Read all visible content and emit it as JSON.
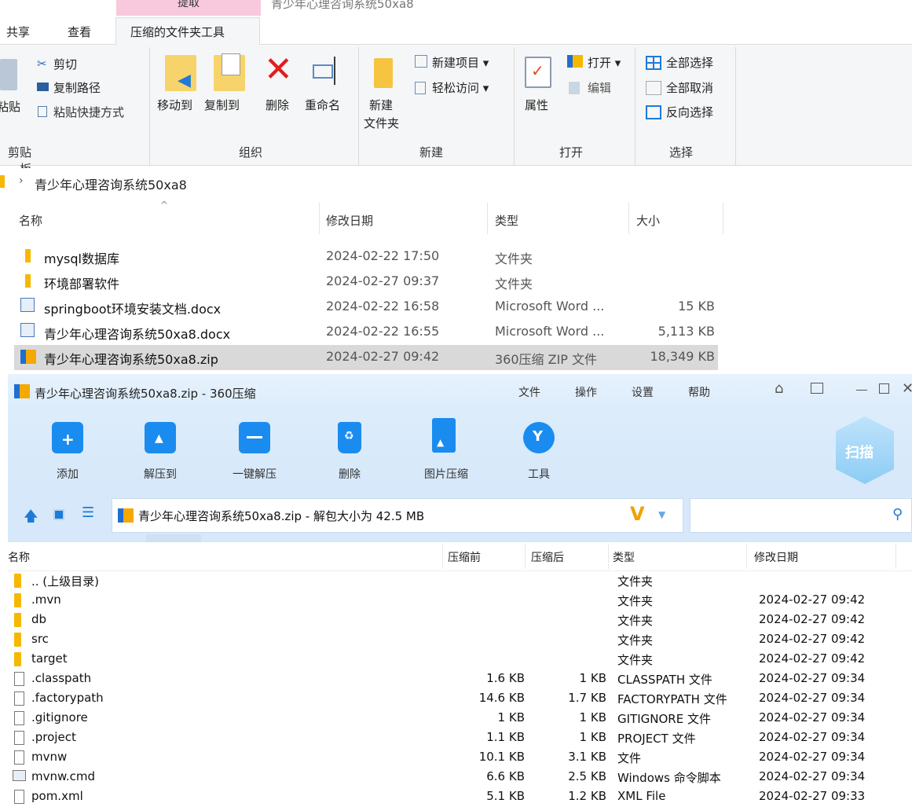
{
  "ribbon": {
    "context_tab": "提取",
    "window_title": "青少年心理咨询系统50xa8",
    "tabs": [
      "共享",
      "查看",
      "压缩的文件夹工具"
    ],
    "clipboard": {
      "paste": "粘贴",
      "cut": "剪切",
      "copy_path": "复制路径",
      "paste_shortcut": "粘贴快捷方式",
      "label": "剪贴板"
    },
    "organize": {
      "move_to": "移动到",
      "copy_to": "复制到",
      "delete": "删除",
      "rename": "重命名",
      "label": "组织"
    },
    "new": {
      "new_folder_1": "新建",
      "new_folder_2": "文件夹",
      "new_item": "新建项目 ▾",
      "easy_access": "轻松访问 ▾",
      "label": "新建"
    },
    "open": {
      "properties": "属性",
      "open": "打开 ▾",
      "edit": "编辑",
      "label": "打开"
    },
    "select": {
      "select_all": "全部选择",
      "select_none": "全部取消",
      "invert": "反向选择",
      "label": "选择"
    }
  },
  "address": {
    "path": "青少年心理咨询系统50xa8"
  },
  "explorer": {
    "columns": {
      "name": "名称",
      "date": "修改日期",
      "type": "类型",
      "size": "大小"
    },
    "rows": [
      {
        "name": "mysql数据库",
        "date": "2024-02-22 17:50",
        "type": "文件夹",
        "size": "",
        "icon": "folder"
      },
      {
        "name": "环境部署软件",
        "date": "2024-02-27 09:37",
        "type": "文件夹",
        "size": "",
        "icon": "folder"
      },
      {
        "name": "springboot环境安装文档.docx",
        "date": "2024-02-22 16:58",
        "type": "Microsoft Word ...",
        "size": "15 KB",
        "icon": "word"
      },
      {
        "name": "青少年心理咨询系统50xa8.docx",
        "date": "2024-02-22 16:55",
        "type": "Microsoft Word ...",
        "size": "5,113 KB",
        "icon": "word"
      },
      {
        "name": "青少年心理咨询系统50xa8.zip",
        "date": "2024-02-27 09:42",
        "type": "360压缩 ZIP 文件",
        "size": "18,349 KB",
        "icon": "zip"
      }
    ]
  },
  "zip": {
    "title": "青少年心理咨询系统50xa8.zip - 360压缩",
    "menu": [
      "文件",
      "操作",
      "设置",
      "帮助"
    ],
    "tools": [
      "添加",
      "解压到",
      "一键解压",
      "删除",
      "图片压缩",
      "工具"
    ],
    "scan": "扫描",
    "path": "青少年心理咨询系统50xa8.zip - 解包大小为 42.5 MB",
    "columns": {
      "name": "名称",
      "before": "压缩前",
      "after": "压缩后",
      "type": "类型",
      "date": "修改日期"
    },
    "rows": [
      {
        "name": ".. (上级目录)",
        "before": "",
        "after": "",
        "type": "文件夹",
        "date": "",
        "icon": "folder"
      },
      {
        "name": ".mvn",
        "before": "",
        "after": "",
        "type": "文件夹",
        "date": "2024-02-27 09:42",
        "icon": "folder"
      },
      {
        "name": "db",
        "before": "",
        "after": "",
        "type": "文件夹",
        "date": "2024-02-27 09:42",
        "icon": "folder"
      },
      {
        "name": "src",
        "before": "",
        "after": "",
        "type": "文件夹",
        "date": "2024-02-27 09:42",
        "icon": "folder"
      },
      {
        "name": "target",
        "before": "",
        "after": "",
        "type": "文件夹",
        "date": "2024-02-27 09:42",
        "icon": "folder"
      },
      {
        "name": ".classpath",
        "before": "1.6 KB",
        "after": "1 KB",
        "type": "CLASSPATH 文件",
        "date": "2024-02-27 09:34",
        "icon": "file"
      },
      {
        "name": ".factorypath",
        "before": "14.6 KB",
        "after": "1.7 KB",
        "type": "FACTORYPATH 文件",
        "date": "2024-02-27 09:34",
        "icon": "file"
      },
      {
        "name": ".gitignore",
        "before": "1 KB",
        "after": "1 KB",
        "type": "GITIGNORE 文件",
        "date": "2024-02-27 09:34",
        "icon": "file"
      },
      {
        "name": ".project",
        "before": "1.1 KB",
        "after": "1 KB",
        "type": "PROJECT 文件",
        "date": "2024-02-27 09:34",
        "icon": "file"
      },
      {
        "name": "mvnw",
        "before": "10.1 KB",
        "after": "3.1 KB",
        "type": "文件",
        "date": "2024-02-27 09:34",
        "icon": "file"
      },
      {
        "name": "mvnw.cmd",
        "before": "6.6 KB",
        "after": "2.5 KB",
        "type": "Windows 命令脚本",
        "date": "2024-02-27 09:34",
        "icon": "cmd"
      },
      {
        "name": "pom.xml",
        "before": "5.1 KB",
        "after": "1.2 KB",
        "type": "XML File",
        "date": "2024-02-27 09:33",
        "icon": "file"
      }
    ]
  }
}
